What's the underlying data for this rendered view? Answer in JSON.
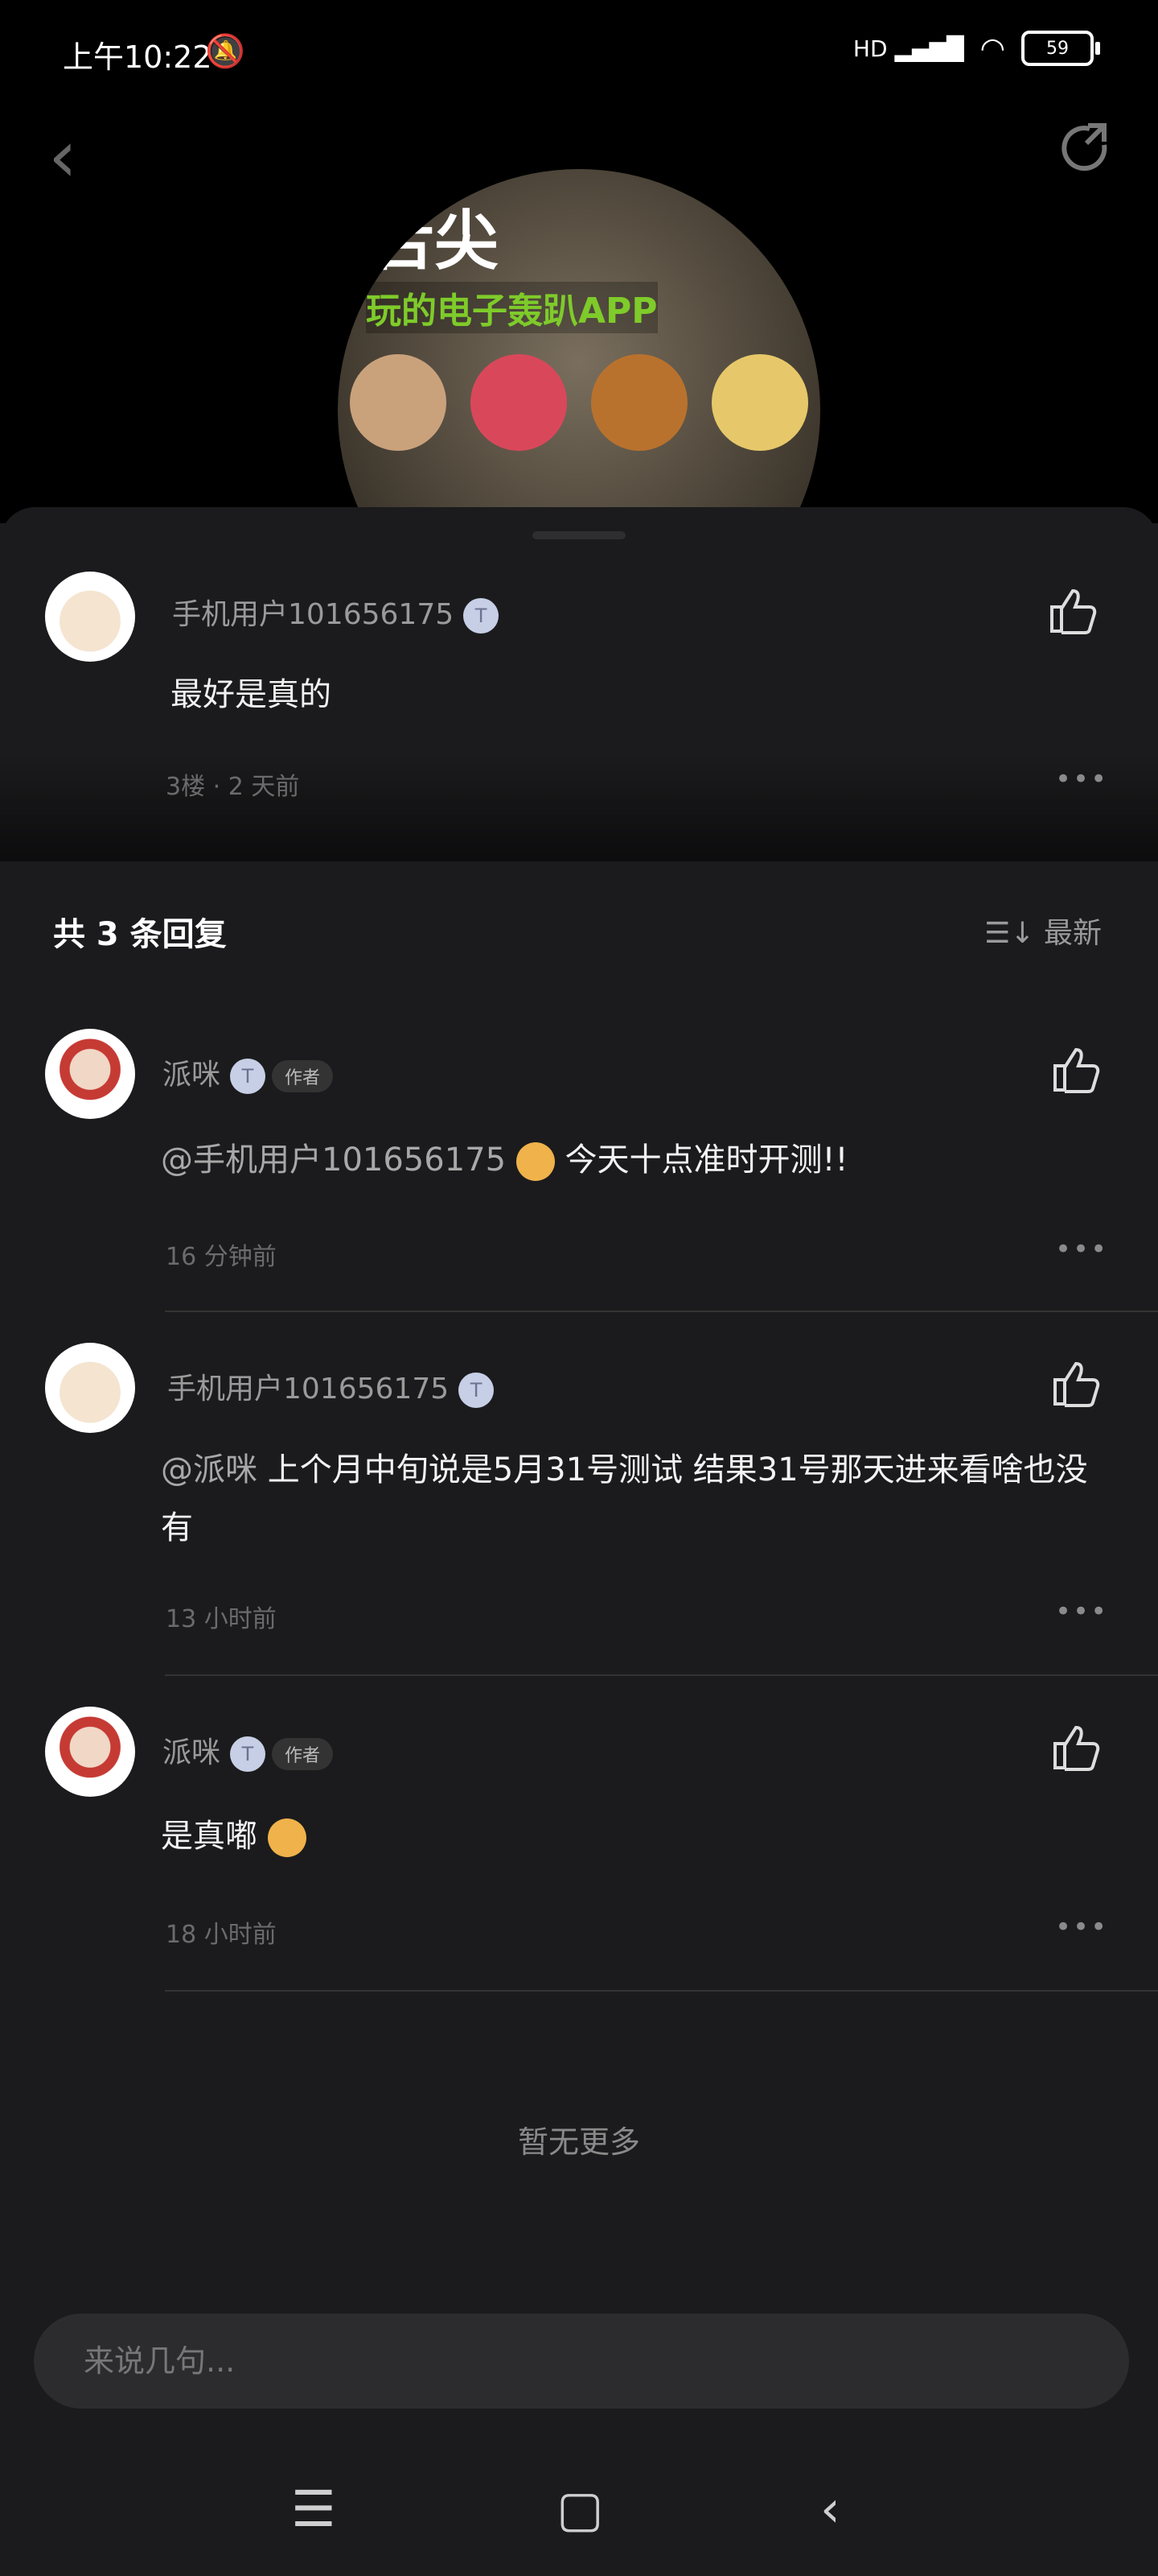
{
  "status_bar": {
    "time": "上午10:22",
    "battery": "59"
  },
  "header": {
    "banner_title": "舌尖",
    "banner_subtitle": "玩的电子轰趴APP"
  },
  "main_comment": {
    "username": "手机用户101656175",
    "level": "T",
    "text": "最好是真的",
    "meta": "3楼 · 2 天前"
  },
  "replies_header": {
    "title": "共 3 条回复",
    "sort_label": "最新"
  },
  "replies": [
    {
      "username": "派咪",
      "badge": "作者",
      "mention": "@手机用户101656175",
      "text": "今天十点准时开测!!",
      "time": "16 分钟前"
    },
    {
      "username": "手机用户101656175",
      "badge": "",
      "mention": "@派咪",
      "text": "上个月中旬说是5月31号测试 结果31号那天进来看啥也没有",
      "time": "13 小时前"
    },
    {
      "username": "派咪",
      "badge": "作者",
      "mention": "",
      "text": "是真嘟",
      "time": "18 小时前"
    }
  ],
  "footer": {
    "no_more": "暂无更多",
    "input_placeholder": "来说几句..."
  },
  "icons": {
    "back": "back-arrow-icon",
    "share": "share-icon",
    "like": "thumbs-up-icon",
    "more": "more-dots-icon",
    "sort": "sort-icon",
    "nav_menu": "menu-icon",
    "nav_home": "home-icon",
    "nav_back": "back-icon"
  }
}
